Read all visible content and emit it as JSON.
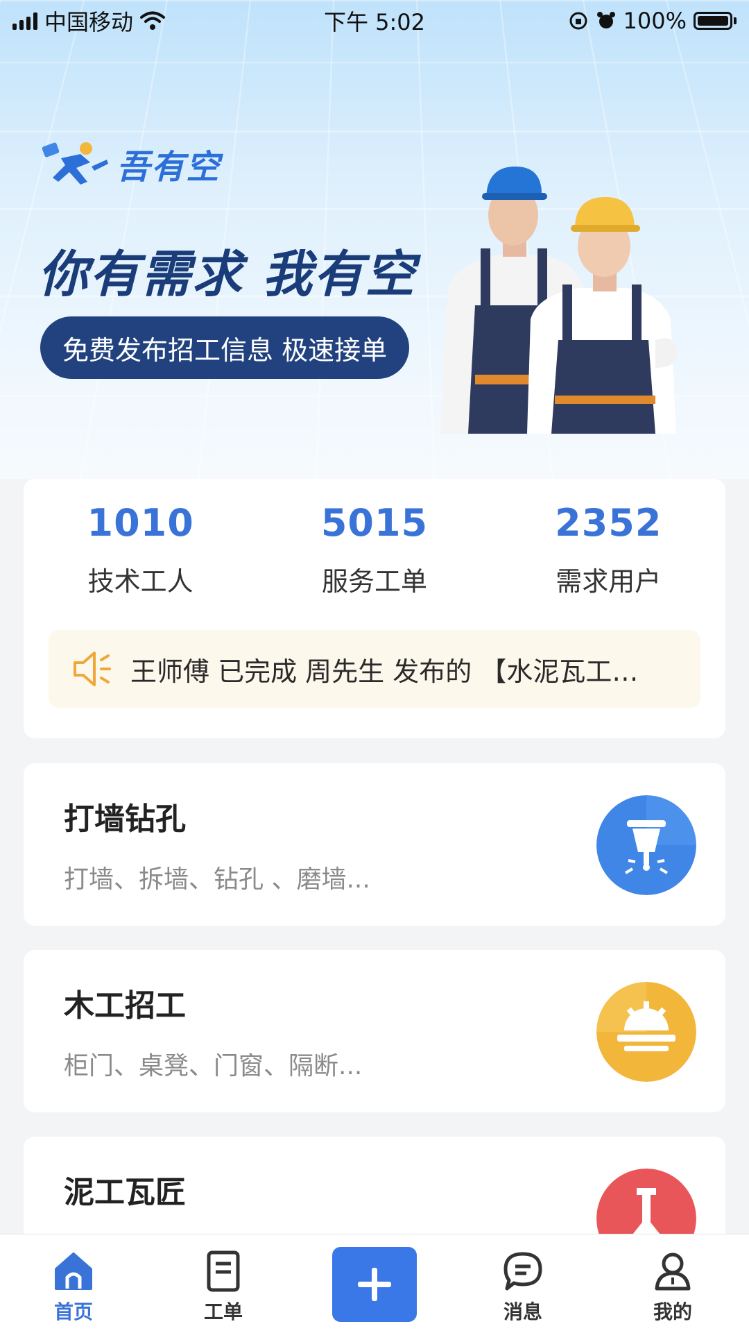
{
  "status_bar": {
    "carrier": "中国移动",
    "time": "下午 5:02",
    "battery": "100%"
  },
  "hero": {
    "brand_name": "吾有空",
    "slogan": "你有需求  我有空",
    "pill_text": "免费发布招工信息 极速接单"
  },
  "stats": [
    {
      "value": "1010",
      "label": "技术工人"
    },
    {
      "value": "5015",
      "label": "服务工单"
    },
    {
      "value": "2352",
      "label": "需求用户"
    }
  ],
  "notice": {
    "icon": "speaker-icon",
    "text": "王师傅 已完成 周先生 发布的 【水泥瓦工…"
  },
  "categories": [
    {
      "title": "打墙钻孔",
      "desc": "打墙、拆墙、钻孔 、磨墙...",
      "icon": "jackhammer-icon",
      "color": "#3f86e6"
    },
    {
      "title": "木工招工",
      "desc": "柜门、桌凳、门窗、隔断...",
      "icon": "saw-icon",
      "color": "#f2b63b"
    },
    {
      "title": "泥工瓦匠",
      "desc": "",
      "icon": "trowel-icon",
      "color": "#e8565a"
    }
  ],
  "tabbar": {
    "items": [
      {
        "label": "首页",
        "icon": "home-icon",
        "active": true
      },
      {
        "label": "工单",
        "icon": "document-icon",
        "active": false
      },
      {
        "label": "",
        "icon": "add-icon",
        "active": false
      },
      {
        "label": "消息",
        "icon": "message-icon",
        "active": false
      },
      {
        "label": "我的",
        "icon": "profile-icon",
        "active": false
      }
    ]
  },
  "colors": {
    "accent": "#3a73d8",
    "hero_dark": "#21427e",
    "notice_bg": "#fdf8ec",
    "notice_icon": "#f0a73a"
  }
}
